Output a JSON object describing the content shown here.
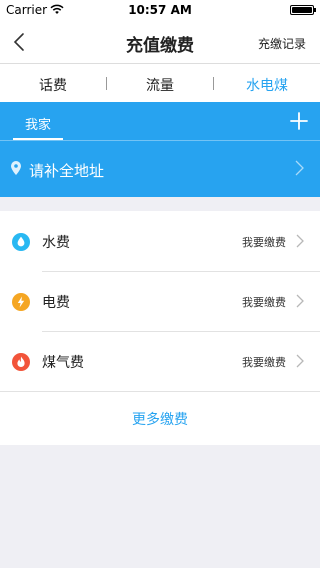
{
  "status_bar": {
    "carrier": "Carrier",
    "time": "10:57 AM"
  },
  "nav": {
    "title": "充值缴费",
    "record_label": "充缴记录"
  },
  "tabs": [
    {
      "label": "话费",
      "active": false
    },
    {
      "label": "流量",
      "active": false
    },
    {
      "label": "水电煤",
      "active": true
    }
  ],
  "panel": {
    "home_tab": "我家",
    "address_prompt": "请补全地址"
  },
  "bills": [
    {
      "label": "水费",
      "action": "我要缴费",
      "icon": "water-drop-icon",
      "color": "#29b8f2"
    },
    {
      "label": "电费",
      "action": "我要缴费",
      "icon": "lightning-icon",
      "color": "#f5a623"
    },
    {
      "label": "煤气费",
      "action": "我要缴费",
      "icon": "flame-icon",
      "color": "#f2543a"
    }
  ],
  "more_label": "更多缴费",
  "colors": {
    "accent": "#27a3f0",
    "background": "#efeff4"
  }
}
